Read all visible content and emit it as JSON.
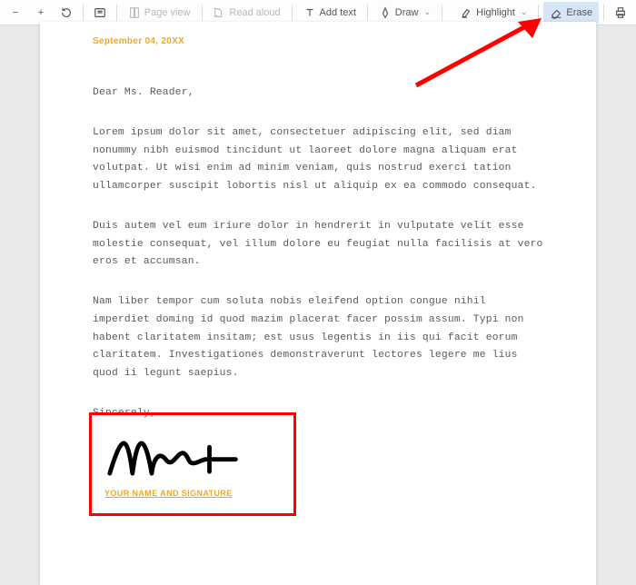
{
  "toolbar": {
    "page_view": "Page view",
    "read_aloud": "Read aloud",
    "add_text": "Add text",
    "draw": "Draw",
    "highlight": "Highlight",
    "erase": "Erase"
  },
  "doc": {
    "date": "September 04, 20XX",
    "greeting": "Dear Ms. Reader,",
    "p1": "Lorem ipsum dolor sit amet, consectetuer adipiscing elit, sed diam nonummy nibh euismod tincidunt ut laoreet dolore magna aliquam erat volutpat. Ut wisi enim ad minim veniam, quis nostrud exerci tation ullamcorper suscipit lobortis nisl ut aliquip ex ea commodo consequat.",
    "p2": "Duis autem vel eum iriure dolor in hendrerit in vulputate velit esse molestie consequat, vel illum dolore eu feugiat nulla facilisis at vero eros et accumsan.",
    "p3": "Nam liber tempor cum soluta nobis eleifend option congue nihil imperdiet doming id quod mazim placerat facer possim assum. Typi non habent claritatem insitam; est usus legentis in iis qui facit eorum claritatem. Investigationes demonstraverunt lectores legere me lius quod ii legunt saepius.",
    "closing": "Sincerely,",
    "signature_label": "YOUR NAME AND SIGNATURE"
  },
  "colors": {
    "accent": "#f2a81d",
    "annotation": "#ff0000"
  }
}
